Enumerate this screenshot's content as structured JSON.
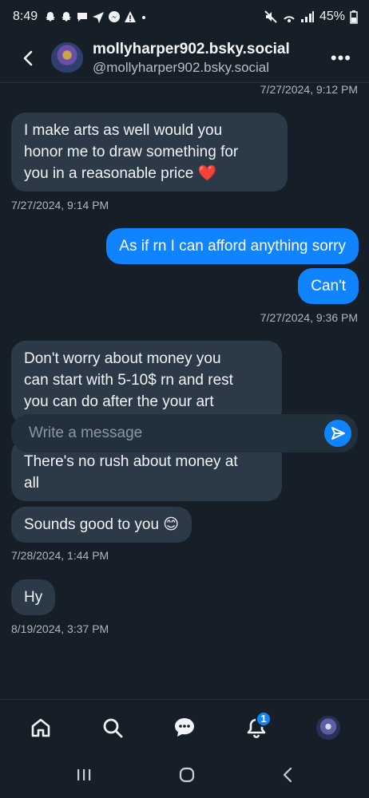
{
  "status_bar": {
    "time": "8:49",
    "battery": "45%",
    "notification_icons": [
      "snapchat-icon",
      "snapchat-icon",
      "message-icon",
      "send-icon",
      "messenger-icon",
      "alert-icon",
      "dot-icon"
    ]
  },
  "header": {
    "display_name": "mollyharper902.bsky.social",
    "handle": "@mollyharper902.bsky.social",
    "more_label": "•••"
  },
  "messages": [
    {
      "kind": "timestamp",
      "side": "right",
      "text": "7/27/2024, 9:12 PM"
    },
    {
      "kind": "bubble",
      "side": "in",
      "lines": [
        "I make arts as well would you",
        "honor me to draw something for",
        "you in a reasonable price ❤️"
      ]
    },
    {
      "kind": "timestamp",
      "side": "left",
      "text": "7/27/2024, 9:14 PM"
    },
    {
      "kind": "bubble",
      "side": "out",
      "lines": [
        "As if rn I can afford anything sorry"
      ]
    },
    {
      "kind": "bubble",
      "side": "out",
      "lines": [
        "Can't"
      ]
    },
    {
      "kind": "timestamp",
      "side": "right",
      "text": "7/27/2024, 9:36 PM"
    },
    {
      "kind": "bubble",
      "side": "in",
      "lines": [
        "Don't worry about money you",
        "can start with 5-10$ rn and rest",
        "you can do after the your art"
      ]
    },
    {
      "kind": "bubble",
      "side": "in",
      "lines": [
        "There's no rush about money at",
        "all"
      ]
    },
    {
      "kind": "bubble",
      "side": "in",
      "lines": [
        "Sounds good to you 😊"
      ]
    },
    {
      "kind": "timestamp",
      "side": "left",
      "text": "7/28/2024, 1:44 PM"
    },
    {
      "kind": "bubble",
      "side": "in",
      "lines": [
        "Hy"
      ]
    },
    {
      "kind": "timestamp",
      "side": "left",
      "text": "8/19/2024, 3:37 PM"
    }
  ],
  "composer": {
    "placeholder": "Write a message"
  },
  "bottom_nav": {
    "items": [
      "home-icon",
      "search-icon",
      "chat-icon",
      "notifications-icon",
      "profile-avatar"
    ],
    "notification_badge": "1"
  },
  "colors": {
    "background": "#161e27",
    "incoming_bubble": "#2c3a47",
    "outgoing_bubble": "#1083fe",
    "accent": "#1083fe"
  }
}
